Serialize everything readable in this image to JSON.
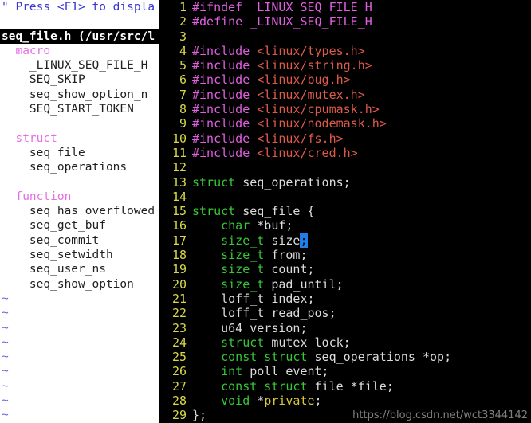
{
  "tagbar": {
    "help_line": "\" Press <F1> to displa",
    "status_line": "seq_file.h (/usr/src/l",
    "rows": [
      {
        "type": "kind",
        "text": "macro"
      },
      {
        "type": "item",
        "text": "_LINUX_SEQ_FILE_H"
      },
      {
        "type": "item",
        "text": "SEQ_SKIP"
      },
      {
        "type": "item",
        "text": "seq_show_option_n"
      },
      {
        "type": "item",
        "text": "SEQ_START_TOKEN"
      },
      {
        "type": "blank",
        "text": ""
      },
      {
        "type": "kind",
        "text": "struct"
      },
      {
        "type": "item",
        "text": "seq_file"
      },
      {
        "type": "item",
        "text": "seq_operations"
      },
      {
        "type": "blank",
        "text": ""
      },
      {
        "type": "kind",
        "text": "function"
      },
      {
        "type": "item",
        "text": "seq_has_overflowed"
      },
      {
        "type": "item",
        "text": "seq_get_buf"
      },
      {
        "type": "item",
        "text": "seq_commit"
      },
      {
        "type": "item",
        "text": "seq_setwidth"
      },
      {
        "type": "item",
        "text": "seq_user_ns"
      },
      {
        "type": "item",
        "text": "seq_show_option"
      },
      {
        "type": "tilde",
        "text": "~"
      },
      {
        "type": "tilde",
        "text": "~"
      },
      {
        "type": "tilde",
        "text": "~"
      },
      {
        "type": "tilde",
        "text": "~"
      },
      {
        "type": "tilde",
        "text": "~"
      },
      {
        "type": "tilde",
        "text": "~"
      },
      {
        "type": "tilde",
        "text": "~"
      },
      {
        "type": "tilde",
        "text": "~"
      },
      {
        "type": "tilde",
        "text": "~"
      }
    ]
  },
  "editor": {
    "filename": "seq_file.h",
    "cursor": {
      "line": 17,
      "col": 17
    },
    "lines": [
      {
        "n": "1",
        "spans": [
          {
            "c": "t-pre",
            "t": "#ifndef _LINUX_SEQ_FILE_H"
          }
        ]
      },
      {
        "n": "2",
        "spans": [
          {
            "c": "t-pre",
            "t": "#define _LINUX_SEQ_FILE_H"
          }
        ]
      },
      {
        "n": "3",
        "spans": []
      },
      {
        "n": "4",
        "spans": [
          {
            "c": "t-pre",
            "t": "#include "
          },
          {
            "c": "t-str",
            "t": "<linux/types.h>"
          }
        ]
      },
      {
        "n": "5",
        "spans": [
          {
            "c": "t-pre",
            "t": "#include "
          },
          {
            "c": "t-str",
            "t": "<linux/string.h>"
          }
        ]
      },
      {
        "n": "6",
        "spans": [
          {
            "c": "t-pre",
            "t": "#include "
          },
          {
            "c": "t-str",
            "t": "<linux/bug.h>"
          }
        ]
      },
      {
        "n": "7",
        "spans": [
          {
            "c": "t-pre",
            "t": "#include "
          },
          {
            "c": "t-str",
            "t": "<linux/mutex.h>"
          }
        ]
      },
      {
        "n": "8",
        "spans": [
          {
            "c": "t-pre",
            "t": "#include "
          },
          {
            "c": "t-str",
            "t": "<linux/cpumask.h>"
          }
        ]
      },
      {
        "n": "9",
        "spans": [
          {
            "c": "t-pre",
            "t": "#include "
          },
          {
            "c": "t-str",
            "t": "<linux/nodemask.h>"
          }
        ]
      },
      {
        "n": "10",
        "spans": [
          {
            "c": "t-pre",
            "t": "#include "
          },
          {
            "c": "t-str",
            "t": "<linux/fs.h>"
          }
        ]
      },
      {
        "n": "11",
        "spans": [
          {
            "c": "t-pre",
            "t": "#include "
          },
          {
            "c": "t-str",
            "t": "<linux/cred.h>"
          }
        ]
      },
      {
        "n": "12",
        "spans": []
      },
      {
        "n": "13",
        "spans": [
          {
            "c": "t-key",
            "t": "struct"
          },
          {
            "c": "t-id",
            "t": " seq_operations;"
          }
        ]
      },
      {
        "n": "14",
        "spans": []
      },
      {
        "n": "15",
        "spans": [
          {
            "c": "t-key",
            "t": "struct"
          },
          {
            "c": "t-id",
            "t": " seq_file {"
          }
        ]
      },
      {
        "n": "16",
        "spans": [
          {
            "c": "t-id",
            "t": "    "
          },
          {
            "c": "t-key",
            "t": "char"
          },
          {
            "c": "t-id",
            "t": " *buf;"
          }
        ]
      },
      {
        "n": "17",
        "spans": [
          {
            "c": "t-id",
            "t": "    "
          },
          {
            "c": "t-key",
            "t": "size_t"
          },
          {
            "c": "t-id",
            "t": " size"
          },
          {
            "c": "t-cursor",
            "t": ";"
          }
        ]
      },
      {
        "n": "18",
        "spans": [
          {
            "c": "t-id",
            "t": "    "
          },
          {
            "c": "t-key",
            "t": "size_t"
          },
          {
            "c": "t-id",
            "t": " from;"
          }
        ]
      },
      {
        "n": "19",
        "spans": [
          {
            "c": "t-id",
            "t": "    "
          },
          {
            "c": "t-key",
            "t": "size_t"
          },
          {
            "c": "t-id",
            "t": " count;"
          }
        ]
      },
      {
        "n": "20",
        "spans": [
          {
            "c": "t-id",
            "t": "    "
          },
          {
            "c": "t-key",
            "t": "size_t"
          },
          {
            "c": "t-id",
            "t": " pad_until;"
          }
        ]
      },
      {
        "n": "21",
        "spans": [
          {
            "c": "t-id",
            "t": "    loff_t index;"
          }
        ]
      },
      {
        "n": "22",
        "spans": [
          {
            "c": "t-id",
            "t": "    loff_t read_pos;"
          }
        ]
      },
      {
        "n": "23",
        "spans": [
          {
            "c": "t-id",
            "t": "    u64 version;"
          }
        ]
      },
      {
        "n": "24",
        "spans": [
          {
            "c": "t-id",
            "t": "    "
          },
          {
            "c": "t-key",
            "t": "struct"
          },
          {
            "c": "t-id",
            "t": " mutex lock;"
          }
        ]
      },
      {
        "n": "25",
        "spans": [
          {
            "c": "t-id",
            "t": "    "
          },
          {
            "c": "t-key",
            "t": "const struct"
          },
          {
            "c": "t-id",
            "t": " seq_operations *op;"
          }
        ]
      },
      {
        "n": "26",
        "spans": [
          {
            "c": "t-id",
            "t": "    "
          },
          {
            "c": "t-key",
            "t": "int"
          },
          {
            "c": "t-id",
            "t": " poll_event;"
          }
        ]
      },
      {
        "n": "27",
        "spans": [
          {
            "c": "t-id",
            "t": "    "
          },
          {
            "c": "t-key",
            "t": "const struct"
          },
          {
            "c": "t-id",
            "t": " file *file;"
          }
        ]
      },
      {
        "n": "28",
        "spans": [
          {
            "c": "t-id",
            "t": "    "
          },
          {
            "c": "t-key",
            "t": "void"
          },
          {
            "c": "t-id",
            "t": " *"
          },
          {
            "c": "t-yellow",
            "t": "private"
          },
          {
            "c": "t-id",
            "t": ";"
          }
        ]
      },
      {
        "n": "29",
        "spans": [
          {
            "c": "t-id",
            "t": "};"
          }
        ]
      }
    ]
  },
  "watermark": {
    "text": "https://blog.csdn.net/wct3344142"
  },
  "colors": {
    "background": "#000000",
    "tagbar_background": "#ffffff",
    "line_number": "#d8d84a",
    "preprocessor": "#e25fe2",
    "string": "#e05a4a",
    "keyword": "#36c736",
    "identifier": "#dcdcdc",
    "cursor": "#1f7fe8",
    "tagbar_kind": "#e36fe3",
    "tilde": "#6a6ae0"
  }
}
